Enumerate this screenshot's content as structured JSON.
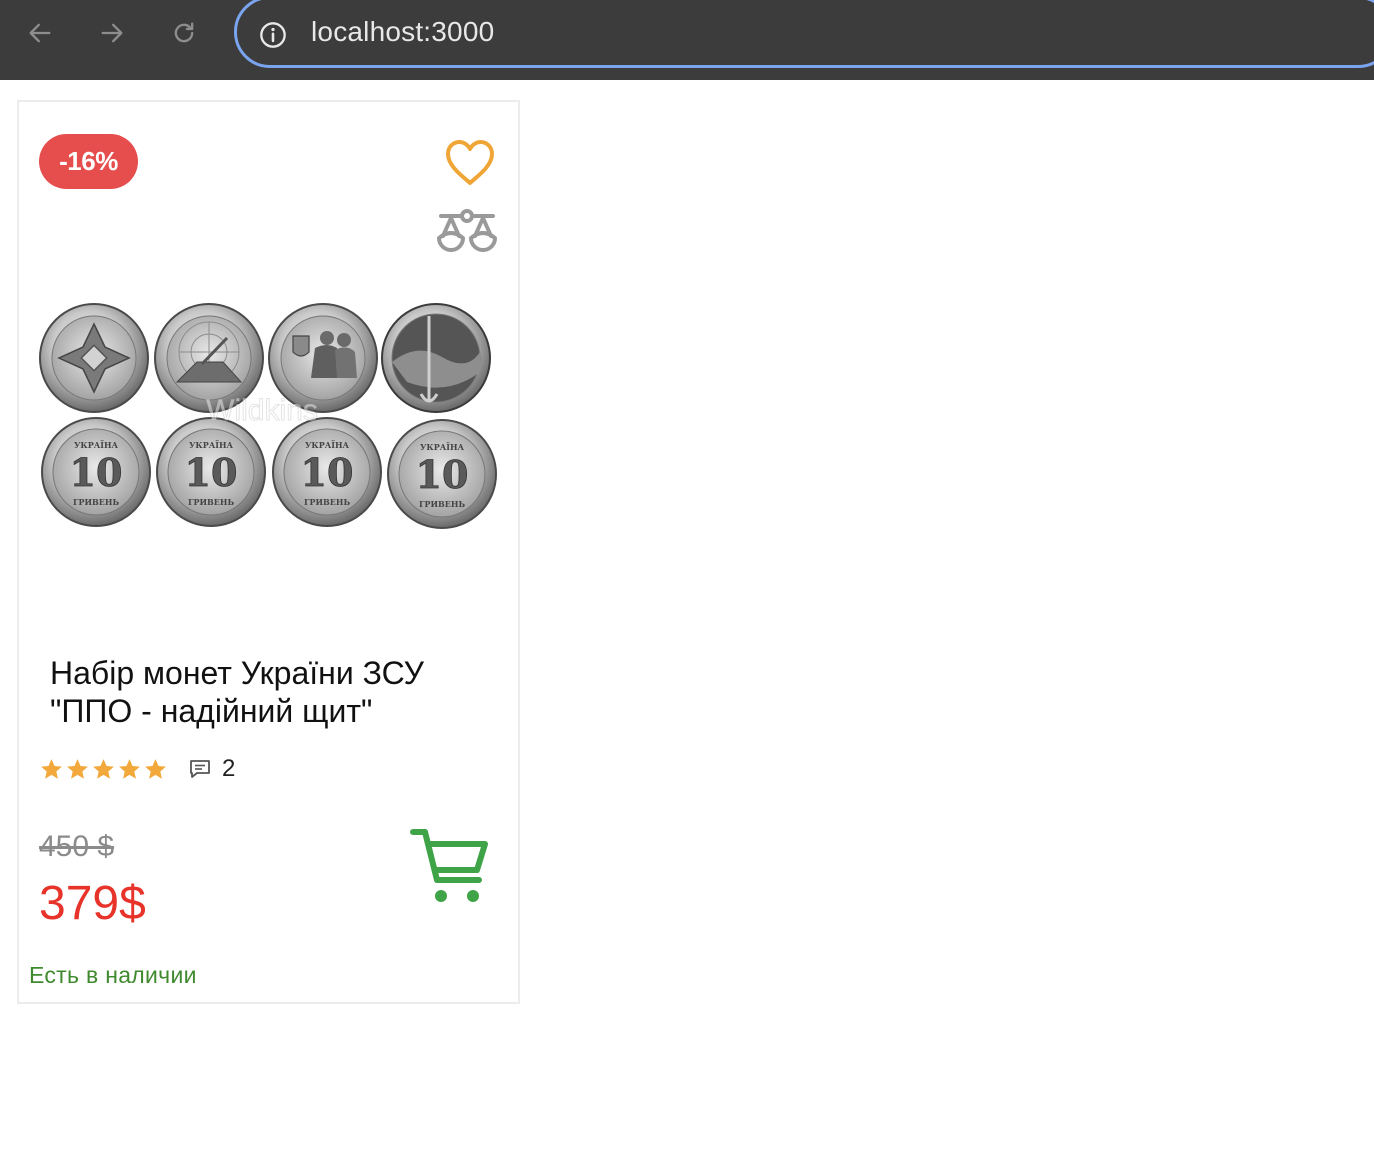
{
  "browser": {
    "url": "localhost:3000",
    "icons": {
      "back": "arrow-left-icon",
      "forward": "arrow-right-icon",
      "reload": "reload-icon",
      "site_info": "info-icon"
    }
  },
  "product_card": {
    "discount_badge": "-16%",
    "icons": {
      "favorite": "heart-icon",
      "compare": "scales-icon",
      "cart": "cart-icon",
      "comments": "comment-icon"
    },
    "image": {
      "watermark": "Wildkins",
      "coin_reverse": {
        "country": "УКРАЇНА",
        "value": "10",
        "currency": "ГРИВЕНЬ"
      }
    },
    "title": "Набір монет України ЗСУ \"ППО - надійний щит\"",
    "rating": 5,
    "reviews_count": "2",
    "old_price": "450 $",
    "price": "379$",
    "stock_status": "Есть в наличии"
  },
  "colors": {
    "discount_badge": "#e64d4d",
    "favorite_icon": "#f0a637",
    "stars": "#f2a83b",
    "price": "#e8332a",
    "cart_icon": "#3fa348",
    "stock_status": "#3f8a2e",
    "browser_bar": "#3c3c3c",
    "address_outline": "#7ba4ee"
  }
}
